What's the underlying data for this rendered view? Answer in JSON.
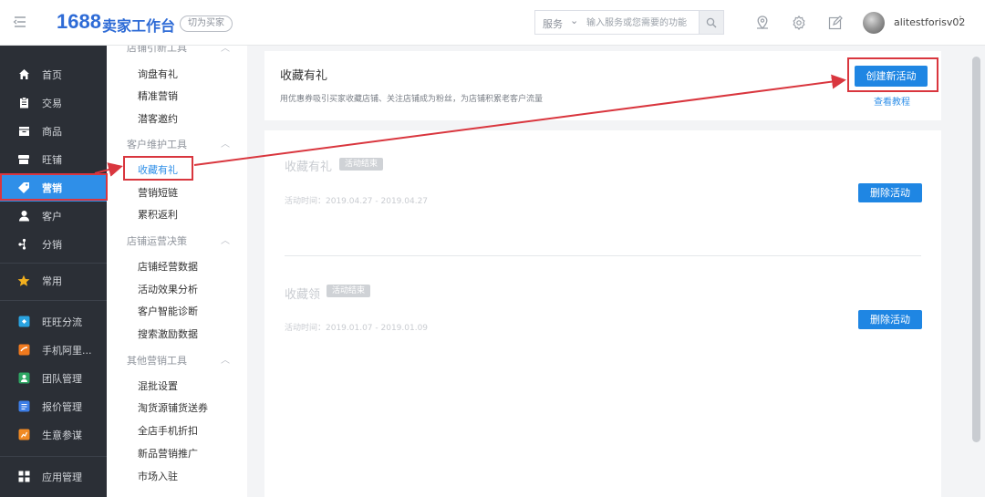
{
  "header": {
    "logo_number": "1688",
    "logo_text": "卖家工作台",
    "switch_label": "切为买家",
    "search": {
      "category": "服务",
      "placeholder": "输入服务或您需要的功能"
    },
    "username": "alitestforisv02"
  },
  "sidebar": {
    "items": [
      {
        "label": "首页",
        "icon": "home-icon"
      },
      {
        "label": "交易",
        "icon": "clipboard-icon"
      },
      {
        "label": "商品",
        "icon": "box-icon"
      },
      {
        "label": "旺铺",
        "icon": "shop-icon"
      },
      {
        "label": "营销",
        "icon": "tag-icon",
        "active": true
      },
      {
        "label": "客户",
        "icon": "user-icon"
      },
      {
        "label": "分销",
        "icon": "distribution-icon"
      },
      {
        "label": "常用",
        "icon": "star-icon"
      },
      {
        "label": "旺旺分流",
        "icon": "wangwang-icon"
      },
      {
        "label": "手机阿里...",
        "icon": "mobile-ali-icon"
      },
      {
        "label": "团队管理",
        "icon": "team-icon"
      },
      {
        "label": "报价管理",
        "icon": "quote-icon"
      },
      {
        "label": "生意参谋",
        "icon": "business-advisor-icon"
      },
      {
        "label": "应用管理",
        "icon": "apps-icon"
      }
    ]
  },
  "submenu": {
    "groups": [
      {
        "title": "店铺引新工具",
        "items": [
          "询盘有礼",
          "精准营销",
          "潜客邀约"
        ]
      },
      {
        "title": "客户维护工具",
        "items": [
          "收藏有礼",
          "营销短链",
          "累积返利"
        ]
      },
      {
        "title": "店铺运营决策",
        "items": [
          "店铺经营数据",
          "活动效果分析",
          "客户智能诊断",
          "搜索激励数据"
        ]
      },
      {
        "title": "其他营销工具",
        "items": [
          "混批设置",
          "淘货源铺货送券",
          "全店手机折扣",
          "新品营销推广",
          "市场入驻"
        ]
      }
    ],
    "active_item": "收藏有礼"
  },
  "main": {
    "title": "收藏有礼",
    "description": "用优惠券吸引买家收藏店铺、关注店铺成为粉丝，为店铺积累老客户流量",
    "create_button": "创建新活动",
    "tutorial_link": "查看教程",
    "activities": [
      {
        "name": "收藏有礼",
        "status": "活动结束",
        "time": "活动时间：2019.04.27 - 2019.04.27",
        "delete_label": "删除活动"
      },
      {
        "name": "收藏领",
        "status": "活动结束",
        "time": "活动时间：2019.01.07 - 2019.01.09",
        "delete_label": "删除活动"
      }
    ]
  },
  "colors": {
    "accent": "#1f86e3",
    "sidebar_bg": "#2b2f36",
    "annotation_red": "#d9363e"
  }
}
